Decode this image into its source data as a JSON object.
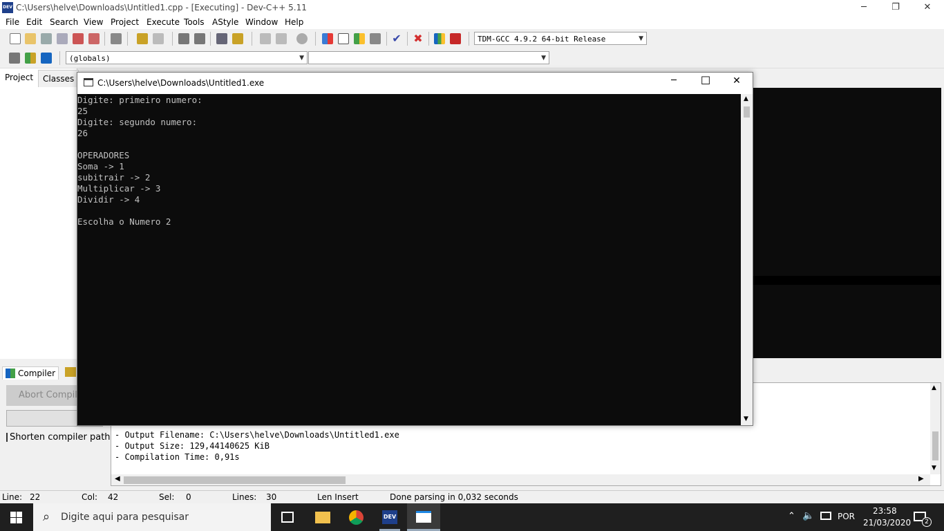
{
  "window": {
    "title": "C:\\Users\\helve\\Downloads\\Untitled1.cpp - [Executing] - Dev-C++ 5.11",
    "app_icon_text": "DEV",
    "minimize": "─",
    "maximize": "❐",
    "close": "✕"
  },
  "menu": [
    "File",
    "Edit",
    "Search",
    "View",
    "Project",
    "Execute",
    "Tools",
    "AStyle",
    "Window",
    "Help"
  ],
  "toolbar": {
    "compiler_select": "TDM-GCC 4.9.2 64-bit Release",
    "scope_select": "(globals)",
    "function_select": ""
  },
  "left_panel": {
    "tabs": [
      "Project",
      "Classes"
    ]
  },
  "bottom_panel": {
    "tabs": [
      "Compiler"
    ],
    "abort_button": "Abort Compilation",
    "shorten_checkbox": "Shorten compiler paths",
    "log_lines": [
      "- Output Filename: C:\\Users\\helve\\Downloads\\Untitled1.exe",
      "- Output Size: 129,44140625 KiB",
      "- Compilation Time: 0,91s"
    ]
  },
  "statusbar": {
    "line_label": "Line:",
    "line_value": "22",
    "col_label": "Col:",
    "col_value": "42",
    "sel_label": "Sel:",
    "sel_value": "0",
    "lines_label": "Lines:",
    "lines_value": "30",
    "mode": "Len Insert",
    "message": "Done parsing in 0,032 seconds"
  },
  "console": {
    "title": "C:\\Users\\helve\\Downloads\\Untitled1.exe",
    "minimize": "─",
    "maximize": "☐",
    "close": "✕",
    "lines": [
      "Digite: primeiro numero:",
      "25",
      "Digite: segundo numero:",
      "26",
      "",
      "OPERADORES",
      "Soma -> 1",
      "subitrair -> 2",
      "Multiplicar -> 3",
      "Dividir -> 4",
      "",
      "Escolha o Numero 2"
    ]
  },
  "taskbar": {
    "search_placeholder": "Digite aqui para pesquisar",
    "language": "POR",
    "time": "23:58",
    "date": "21/03/2020",
    "notification_count": "2"
  }
}
